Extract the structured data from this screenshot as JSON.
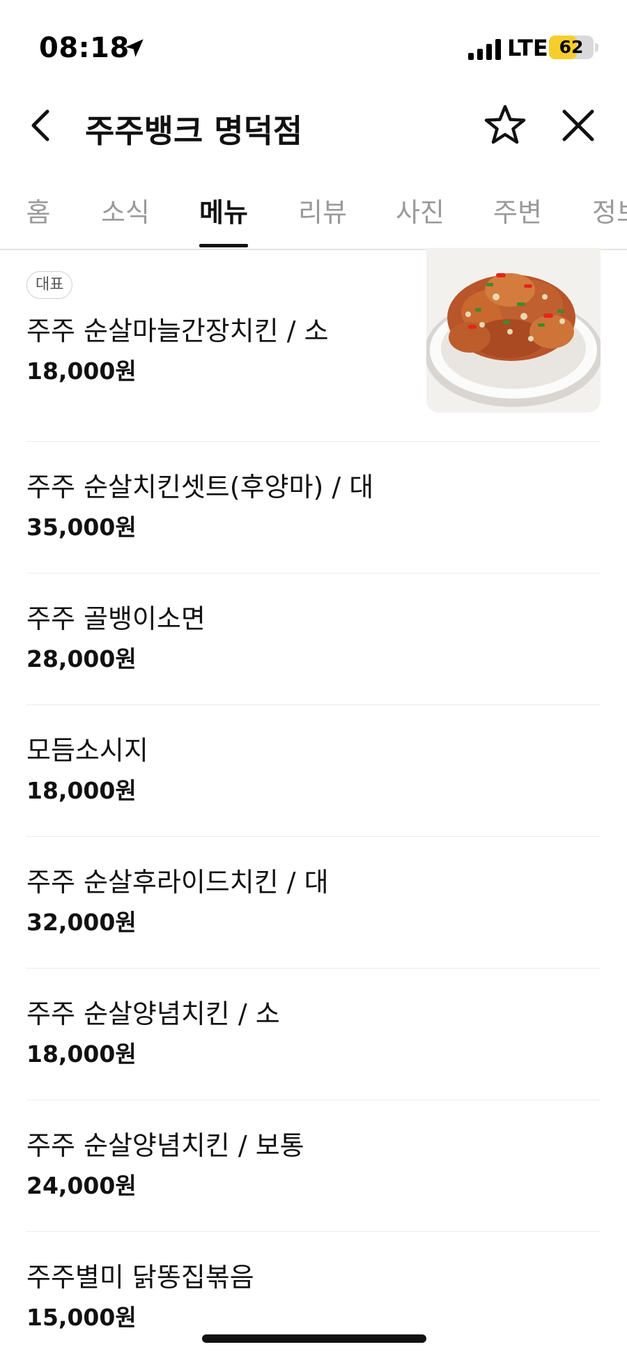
{
  "status_bar": {
    "time": "08:18",
    "network": "LTE",
    "battery_level": "62",
    "battery_fraction": 0.62
  },
  "header": {
    "title": "주주뱅크 명덕점"
  },
  "tabs": [
    {
      "label": "홈",
      "active": false
    },
    {
      "label": "소식",
      "active": false
    },
    {
      "label": "메뉴",
      "active": true
    },
    {
      "label": "리뷰",
      "active": false
    },
    {
      "label": "사진",
      "active": false
    },
    {
      "label": "주변",
      "active": false
    },
    {
      "label": "정보",
      "active": false
    }
  ],
  "menu": {
    "representative_badge": "대표",
    "items": [
      {
        "name": "주주 순살마늘간장치킨 / 소",
        "price": "18,000원"
      },
      {
        "name": "주주 순살치킨셋트(후양마) / 대",
        "price": "35,000원"
      },
      {
        "name": "주주 골뱅이소면",
        "price": "28,000원"
      },
      {
        "name": "모듬소시지",
        "price": "18,000원"
      },
      {
        "name": "주주 순살후라이드치킨 / 대",
        "price": "32,000원"
      },
      {
        "name": "주주 순살양념치킨 / 소",
        "price": "18,000원"
      },
      {
        "name": "주주 순살양념치킨 / 보통",
        "price": "24,000원"
      },
      {
        "name": "주주별미 닭똥집볶음",
        "price": "15,000원"
      }
    ]
  },
  "icons": {
    "location": "location-arrow-icon",
    "signal": "cellular-signal-icon",
    "back": "back-arrow-icon",
    "favorite": "star-icon",
    "close": "close-icon"
  },
  "colors": {
    "battery_fill": "#f6ce2c",
    "active_tab": "#111111",
    "inactive_tab": "#9a9a9a"
  }
}
